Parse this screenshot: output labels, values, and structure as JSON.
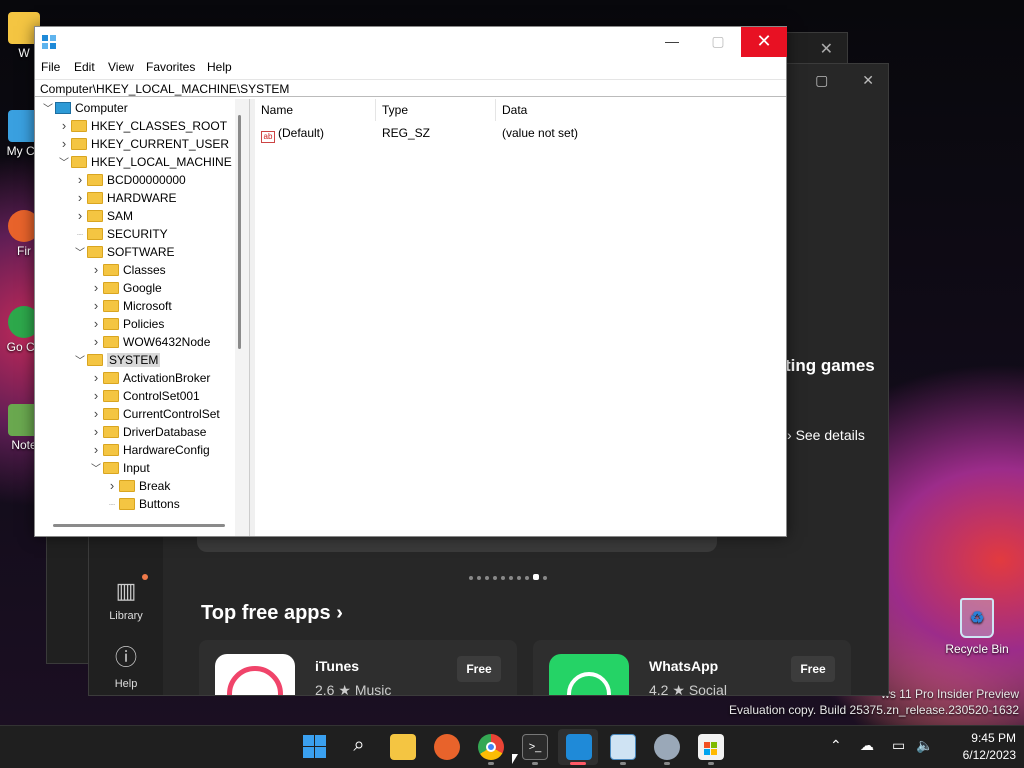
{
  "desktop": {
    "icons": [
      {
        "label": "W"
      },
      {
        "label": "My Co"
      },
      {
        "label": "Fir"
      },
      {
        "label": "Go Ch"
      },
      {
        "label": "Note"
      }
    ],
    "recycle_bin": "Recycle Bin",
    "watermark_line1": "ws 11 Pro Insider Preview",
    "watermark_line2": "Evaluation copy. Build 25375.zn_release.230520-1632"
  },
  "store": {
    "hero_text": "ting games",
    "see_details": "See details",
    "nav": {
      "library": "Library",
      "help": "Help"
    },
    "section_title": "Top free apps",
    "apps": [
      {
        "name": "iTunes",
        "rating": "2.6",
        "category": "Music",
        "price": "Free",
        "color": "#ffffff"
      },
      {
        "name": "WhatsApp",
        "rating": "4.2",
        "category": "Social",
        "price": "Free",
        "color": "#25d366"
      }
    ]
  },
  "regedit": {
    "menu": [
      "File",
      "Edit",
      "View",
      "Favorites",
      "Help"
    ],
    "address": "Computer\\HKEY_LOCAL_MACHINE\\SYSTEM",
    "tree": [
      {
        "label": "Computer",
        "level": 0,
        "expanded": true,
        "icon": "computer-icon"
      },
      {
        "label": "HKEY_CLASSES_ROOT",
        "level": 1,
        "expanded": false
      },
      {
        "label": "HKEY_CURRENT_USER",
        "level": 1,
        "expanded": false
      },
      {
        "label": "HKEY_LOCAL_MACHINE",
        "level": 1,
        "expanded": true
      },
      {
        "label": "BCD00000000",
        "level": 2,
        "expanded": false
      },
      {
        "label": "HARDWARE",
        "level": 2,
        "expanded": false
      },
      {
        "label": "SAM",
        "level": 2,
        "expanded": false
      },
      {
        "label": "SECURITY",
        "level": 2,
        "leaf": true
      },
      {
        "label": "SOFTWARE",
        "level": 2,
        "expanded": true
      },
      {
        "label": "Classes",
        "level": 3,
        "expanded": false
      },
      {
        "label": "Google",
        "level": 3,
        "expanded": false
      },
      {
        "label": "Microsoft",
        "level": 3,
        "expanded": false
      },
      {
        "label": "Policies",
        "level": 3,
        "expanded": false
      },
      {
        "label": "WOW6432Node",
        "level": 3,
        "expanded": false
      },
      {
        "label": "SYSTEM",
        "level": 2,
        "expanded": true,
        "selected": true
      },
      {
        "label": "ActivationBroker",
        "level": 3,
        "expanded": false
      },
      {
        "label": "ControlSet001",
        "level": 3,
        "expanded": false
      },
      {
        "label": "CurrentControlSet",
        "level": 3,
        "expanded": false
      },
      {
        "label": "DriverDatabase",
        "level": 3,
        "expanded": false
      },
      {
        "label": "HardwareConfig",
        "level": 3,
        "expanded": false
      },
      {
        "label": "Input",
        "level": 3,
        "expanded": true
      },
      {
        "label": "Break",
        "level": 4,
        "expanded": false
      },
      {
        "label": "Buttons",
        "level": 4,
        "leaf": true
      }
    ],
    "columns": [
      "Name",
      "Type",
      "Data"
    ],
    "values": [
      {
        "name": "(Default)",
        "type": "REG_SZ",
        "data": "(value not set)"
      }
    ]
  },
  "taskbar": {
    "icons": [
      "windows-start-icon",
      "search-icon",
      "file-explorer-icon",
      "firefox-icon",
      "chrome-icon",
      "terminal-icon",
      "regedit-icon",
      "performance-monitor-icon",
      "settings-icon",
      "store-icon"
    ],
    "time": "9:45 PM",
    "date": "6/12/2023"
  }
}
